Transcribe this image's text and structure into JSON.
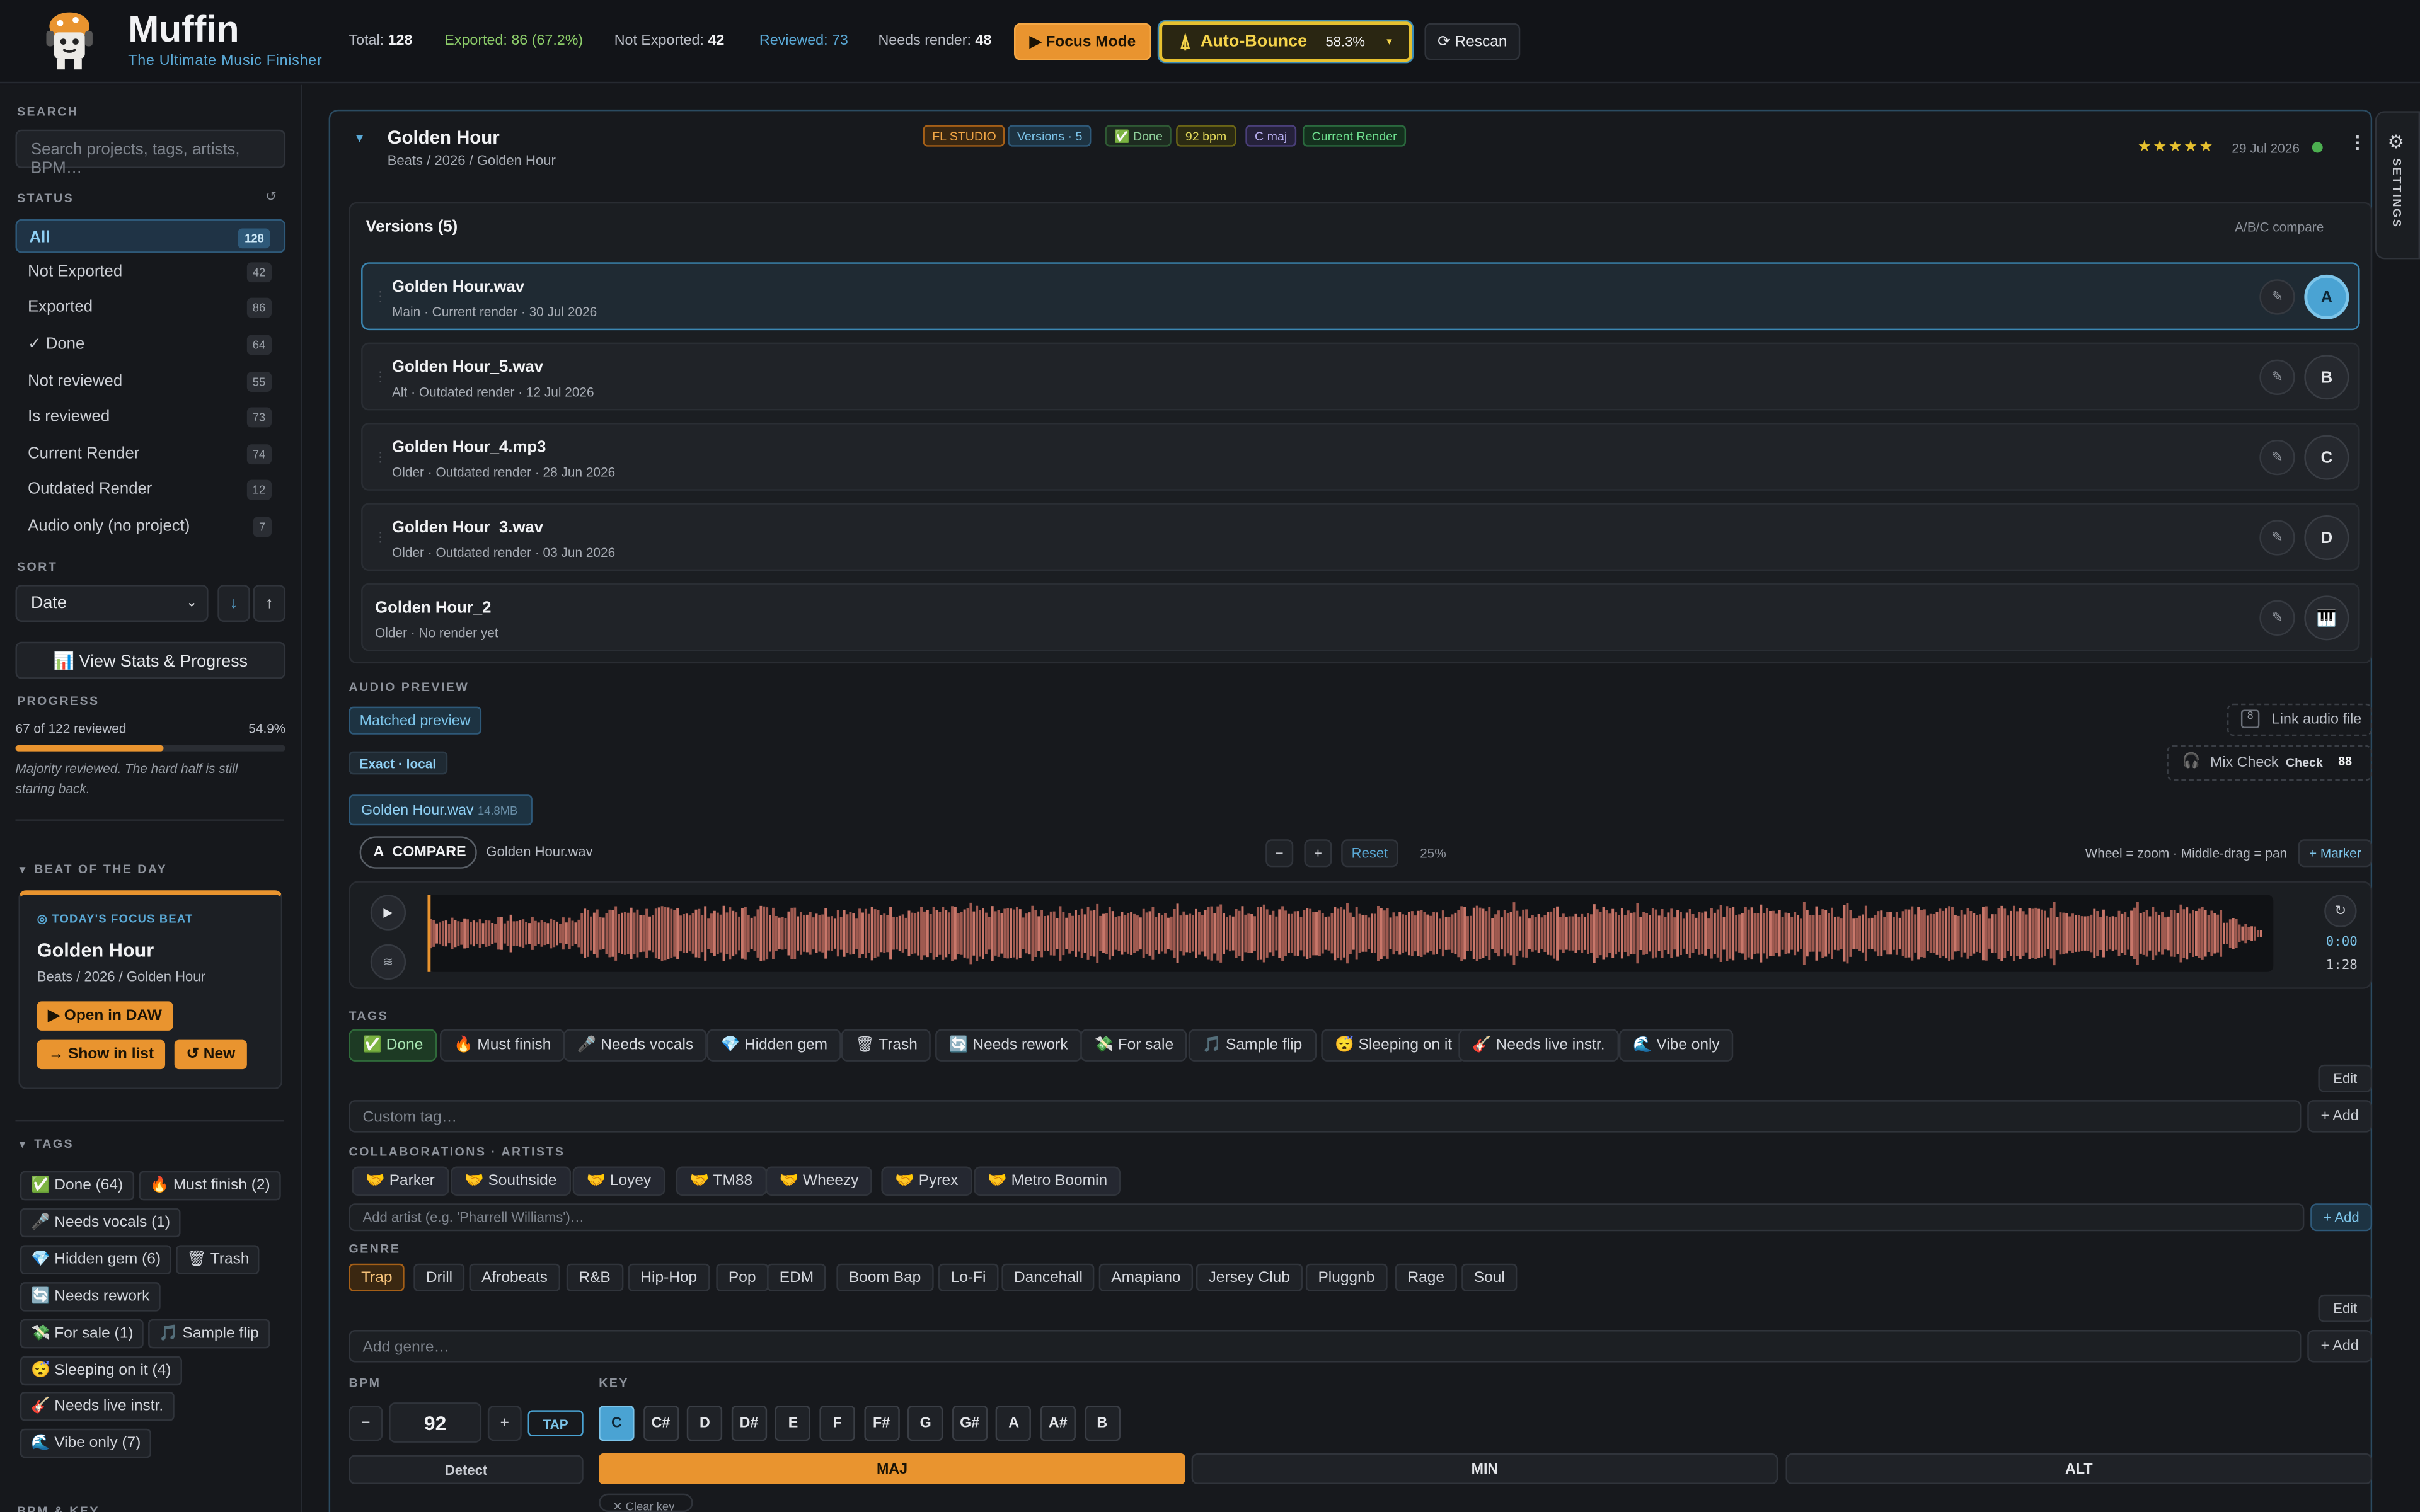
{
  "app": {
    "name": "Muffin",
    "tagline": "The Ultimate Music Finisher"
  },
  "header": {
    "total_label": "Total:",
    "total": "128",
    "exported": "Exported: 86 (67.2%)",
    "not_exported_label": "Not Exported:",
    "not_exported": "42",
    "reviewed": "Reviewed: 73",
    "needs_render_label": "Needs render:",
    "needs_render": "48",
    "focus_label": "▶ Focus Mode",
    "auto_bounce_label": "Auto-Bounce",
    "auto_bounce_pct": "58.3%",
    "rescan_label": "⟳ Rescan"
  },
  "sidebar": {
    "search_label": "SEARCH",
    "search_placeholder": "Search projects, tags, artists, BPM…",
    "status_label": "STATUS",
    "filters": [
      {
        "label": "All",
        "count": "128"
      },
      {
        "label": "Not Exported",
        "count": "42"
      },
      {
        "label": "Exported",
        "count": "86"
      },
      {
        "label": "✓ Done",
        "count": "64"
      },
      {
        "label": "Not reviewed",
        "count": "55"
      },
      {
        "label": "Is reviewed",
        "count": "73"
      },
      {
        "label": "Current Render",
        "count": "74"
      },
      {
        "label": "Outdated Render",
        "count": "12"
      },
      {
        "label": "Audio only (no project)",
        "count": "7"
      }
    ],
    "sort_label": "SORT",
    "sort_value": "Date",
    "sort_desc": "↓",
    "sort_asc": "↑",
    "stats_button": "📊 View Stats & Progress",
    "progress_label": "PROGRESS",
    "progress_text": "67 of 122 reviewed",
    "progress_pct": "54.9%",
    "progress_value": 54.9,
    "progress_note": "Majority reviewed. The hard half is still staring back.",
    "beat_section": "BEAT OF THE DAY",
    "beat_kicker": "◎ TODAY'S FOCUS BEAT",
    "beat_title": "Golden Hour",
    "beat_path": "Beats / 2026 / Golden Hour",
    "open_daw": "▶ Open in DAW",
    "show_list": "→ Show in list",
    "new_btn": "↺ New",
    "tags_section": "TAGS",
    "tags": [
      "✅ Done (64)",
      "🔥 Must finish (2)",
      "🎤 Needs vocals (1)",
      "💎 Hidden gem (6)",
      "🗑 Trash",
      "🔄 Needs rework",
      "💸 For sale (1)",
      "🎵 Sample flip",
      "😴 Sleeping on it (4)",
      "🎸 Needs live instr.",
      "🌊 Vibe only (7)"
    ],
    "bottom_label": "BPM & KEY"
  },
  "project": {
    "title": "Golden Hour",
    "path": "Beats / 2026 / Golden Hour",
    "badges": [
      "FL STUDIO",
      "Versions · 5",
      "✅ Done",
      "92 bpm",
      "C maj",
      "Current Render"
    ],
    "stars": "★★★★★",
    "date": "29 Jul 2026",
    "versions_title": "Versions (5)",
    "abc_label": "A/B/C compare",
    "versions": [
      {
        "name": "Golden Hour.wav",
        "sub": "Main · Current render · 30 Jul 2026",
        "slot": "A"
      },
      {
        "name": "Golden Hour_5.wav",
        "sub": "Alt · Outdated render · 12 Jul 2026",
        "slot": "B"
      },
      {
        "name": "Golden Hour_4.mp3",
        "sub": "Older · Outdated render · 28 Jun 2026",
        "slot": "C"
      },
      {
        "name": "Golden Hour_3.wav",
        "sub": "Older · Outdated render · 03 Jun 2026",
        "slot": "D"
      },
      {
        "name": "Golden Hour_2",
        "sub": "Older · No render yet",
        "slot": "🎹"
      }
    ],
    "settings_label": "SETTINGS"
  },
  "audio": {
    "section": "AUDIO PREVIEW",
    "matched": "Matched preview",
    "link_audio": "Link audio file",
    "exact": "Exact · local",
    "mix_check": "Mix Check",
    "mix_check_sub": "Check",
    "mix_score": "88",
    "file_chip": "Golden Hour.wav",
    "file_size": "14.8MB",
    "compare": "COMPARE",
    "compare_file": "Golden Hour.wav",
    "minus": "−",
    "plus": "+",
    "reset": "Reset",
    "zoom": "25%",
    "hint": "Wheel = zoom · Middle-drag = pan",
    "marker": "+ Marker",
    "time_current": "0:00",
    "time_total": "1:28"
  },
  "tags": {
    "section": "TAGS",
    "items": [
      "✅ Done",
      "🔥 Must finish",
      "🎤 Needs vocals",
      "💎 Hidden gem",
      "🗑 Trash",
      "🔄 Needs rework",
      "💸 For sale",
      "🎵 Sample flip",
      "😴 Sleeping on it",
      "🎸 Needs live instr.",
      "🌊 Vibe only"
    ],
    "edit": "Edit",
    "custom_placeholder": "Custom tag…",
    "add": "+ Add"
  },
  "collab": {
    "section": "COLLABORATIONS · ARTISTS",
    "artists": [
      "🤝 Parker",
      "🤝 Southside",
      "🤝 Loyey",
      "🤝 TM88",
      "🤝 Wheezy",
      "🤝 Pyrex",
      "🤝 Metro Boomin"
    ],
    "placeholder": "Add artist (e.g. 'Pharrell Williams')…",
    "add": "+ Add"
  },
  "genre": {
    "section": "GENRE",
    "items": [
      "Trap",
      "Drill",
      "Afrobeats",
      "R&B",
      "Hip-Hop",
      "Pop",
      "EDM",
      "Boom Bap",
      "Lo-Fi",
      "Dancehall",
      "Amapiano",
      "Jersey Club",
      "Pluggnb",
      "Rage",
      "Soul"
    ],
    "edit": "Edit",
    "placeholder": "Add genre…",
    "add": "+ Add"
  },
  "bpm": {
    "label": "BPM",
    "value": "92",
    "minus": "−",
    "plus": "+",
    "tap": "TAP",
    "detect": "Detect"
  },
  "key": {
    "label": "KEY",
    "notes": [
      "C",
      "C#",
      "D",
      "D#",
      "E",
      "F",
      "F#",
      "G",
      "G#",
      "A",
      "A#",
      "B"
    ],
    "modes": [
      "MAJ",
      "MIN",
      "ALT"
    ],
    "clear": "✕ Clear key"
  },
  "colors": {
    "accent": "#e9942f",
    "blue": "#4aa3d3",
    "bg": "#15171b"
  }
}
